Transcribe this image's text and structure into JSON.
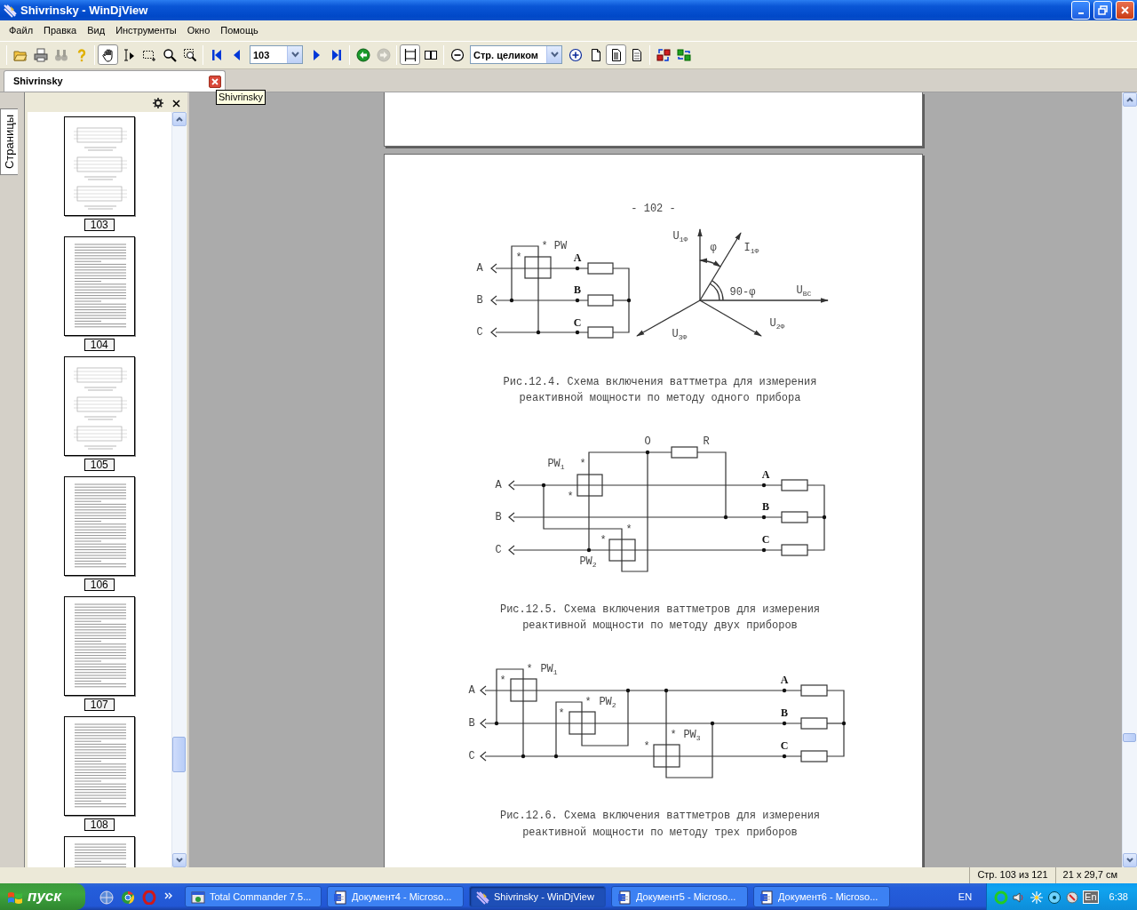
{
  "window": {
    "title": "Shivrinsky - WinDjView"
  },
  "menu": [
    "Файл",
    "Правка",
    "Вид",
    "Инструменты",
    "Окно",
    "Помощь"
  ],
  "toolbar": [
    [
      {
        "kind": "button",
        "disabled": false
      },
      {
        "kind": "button",
        "disabled": false
      },
      {
        "kind": "button",
        "disabled": true
      },
      {
        "kind": "button",
        "disabled": false
      }
    ],
    [
      {
        "kind": "toggle",
        "selected": true
      },
      {
        "kind": "toggle",
        "selected": false
      },
      {
        "kind": "toggle",
        "selected": false
      },
      {
        "kind": "toggle",
        "selected": false
      },
      {
        "kind": "toggle",
        "selected": false
      }
    ],
    [
      {
        "kind": "button",
        "disabled": false
      },
      {
        "kind": "button",
        "disabled": false
      },
      {
        "kind": "combo",
        "value": "103"
      },
      {
        "kind": "button",
        "disabled": false
      },
      {
        "kind": "button",
        "disabled": false
      }
    ],
    [
      {
        "kind": "button",
        "disabled": false
      },
      {
        "kind": "button",
        "disabled": true
      }
    ],
    [
      {
        "kind": "toggle",
        "selected": true
      },
      {
        "kind": "toggle",
        "selected": false
      }
    ],
    [
      {
        "kind": "button",
        "disabled": false
      },
      {
        "kind": "combo",
        "value": "Стр. целиком"
      },
      {
        "kind": "button",
        "disabled": false
      },
      {
        "kind": "toggle",
        "selected": false
      },
      {
        "kind": "toggle",
        "selected": true
      },
      {
        "kind": "toggle",
        "selected": false
      }
    ],
    [
      {
        "kind": "button",
        "disabled": false
      },
      {
        "kind": "button",
        "disabled": false
      }
    ]
  ],
  "document_tabs": [
    {
      "label": "Shivrinsky",
      "selected": true
    }
  ],
  "tooltip": "Shivrinsky",
  "sidebar": {
    "tab": "Страницы",
    "thumbnails": [
      {
        "label": "103",
        "kind": "diagrams"
      },
      {
        "label": "104",
        "kind": "text"
      },
      {
        "label": "105",
        "kind": "diagrams"
      },
      {
        "label": "106",
        "kind": "text"
      },
      {
        "label": "107",
        "kind": "text"
      },
      {
        "label": "108",
        "kind": "text"
      },
      {
        "kind": "text"
      }
    ]
  },
  "page": {
    "page_number": "- 102 -",
    "figures": [
      {
        "labels": [
          "A",
          "B",
          "C",
          "A",
          "B",
          "C",
          "*",
          "*",
          "PW",
          "U$_{1Ф}$",
          "φ",
          "I$_{1Ф}$",
          "90-φ",
          "U$_{BC}$",
          "U$_{2Ф}$",
          "U$_{3Ф}$"
        ],
        "caption": [
          "Рис.12.4. Схема включения ваттметра для измерения",
          "реактивной мощности по методу одного прибора"
        ]
      },
      {
        "labels": [
          "O",
          "R",
          "PW$_{1}$",
          "*",
          "A",
          "A",
          "*",
          "B",
          "B",
          "*",
          "*",
          "C",
          "C",
          "PW$_{2}$"
        ],
        "caption": [
          "Рис.12.5. Схема включения ваттметров для измерения",
          "реактивной мощности по методу двух приборов"
        ]
      },
      {
        "labels": [
          "*",
          "PW$_{1}$",
          "*",
          "A",
          "A",
          "*",
          "PW$_{2}$",
          "*",
          "B",
          "B",
          "*",
          "PW$_{3}$",
          "*",
          "C",
          "C"
        ],
        "caption": [
          "Рис.12.6. Схема включения ваттметров для измерения",
          "реактивной мощности по методу трех приборов"
        ]
      }
    ]
  },
  "status_bar": [
    "Стр. 103 из 121",
    "21 x 29,7 см"
  ],
  "taskbar": {
    "start": "пуск",
    "tasks": [
      {
        "label": "Total Commander 7.5...",
        "kind": "commander",
        "selected": false
      },
      {
        "label": "Документ4 - Microso...",
        "kind": "word",
        "selected": false
      },
      {
        "label": "Shivrinsky - WinDjView",
        "kind": "djview",
        "selected": true
      },
      {
        "label": "Документ5 - Microso...",
        "kind": "word",
        "selected": false
      },
      {
        "label": "Документ6 - Microso...",
        "kind": "word",
        "selected": false
      }
    ],
    "language": "EN",
    "tray_language": "En",
    "clock": "6:38"
  }
}
